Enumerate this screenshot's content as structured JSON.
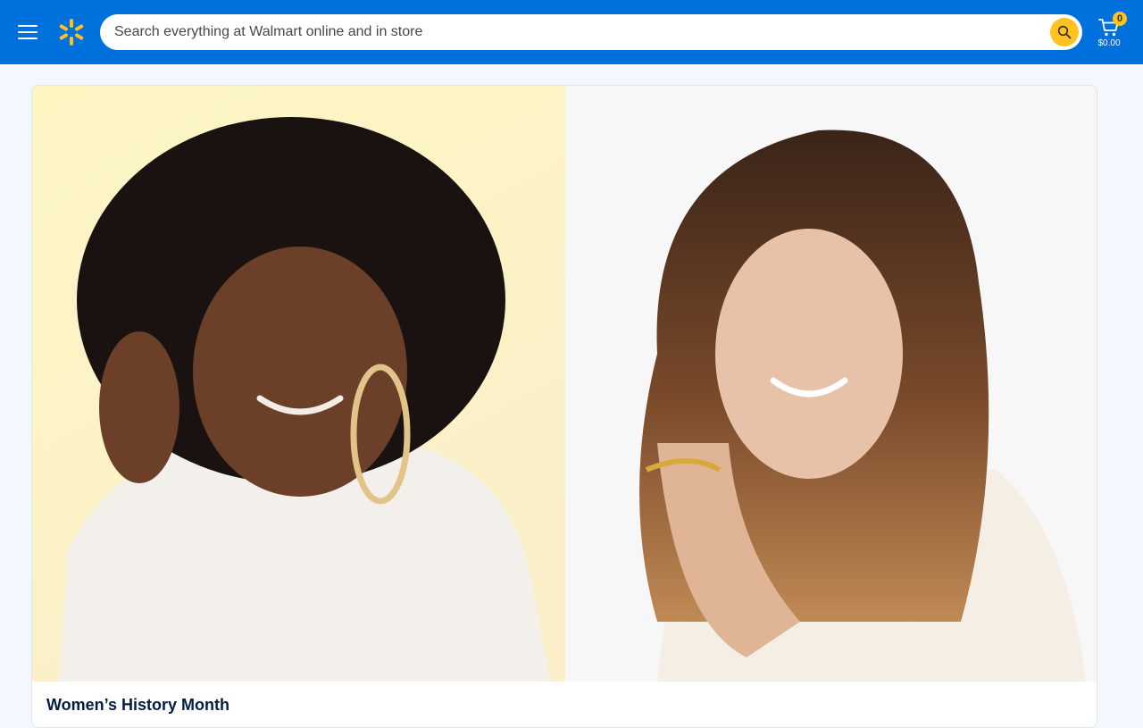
{
  "brand": {
    "primary_color": "#0071dc",
    "spark_color": "#ffc220"
  },
  "header": {
    "menu_icon": "hamburger-menu-icon",
    "logo_icon": "walmart-spark-icon",
    "search": {
      "placeholder": "Search everything at Walmart online and in store",
      "value": "",
      "button_icon": "search-icon"
    },
    "cart": {
      "icon": "cart-icon",
      "count": "0",
      "total": "$0.00"
    }
  },
  "main": {
    "feature_card": {
      "image": "two-women-portrait-photo",
      "title": "Women’s History Month"
    }
  }
}
